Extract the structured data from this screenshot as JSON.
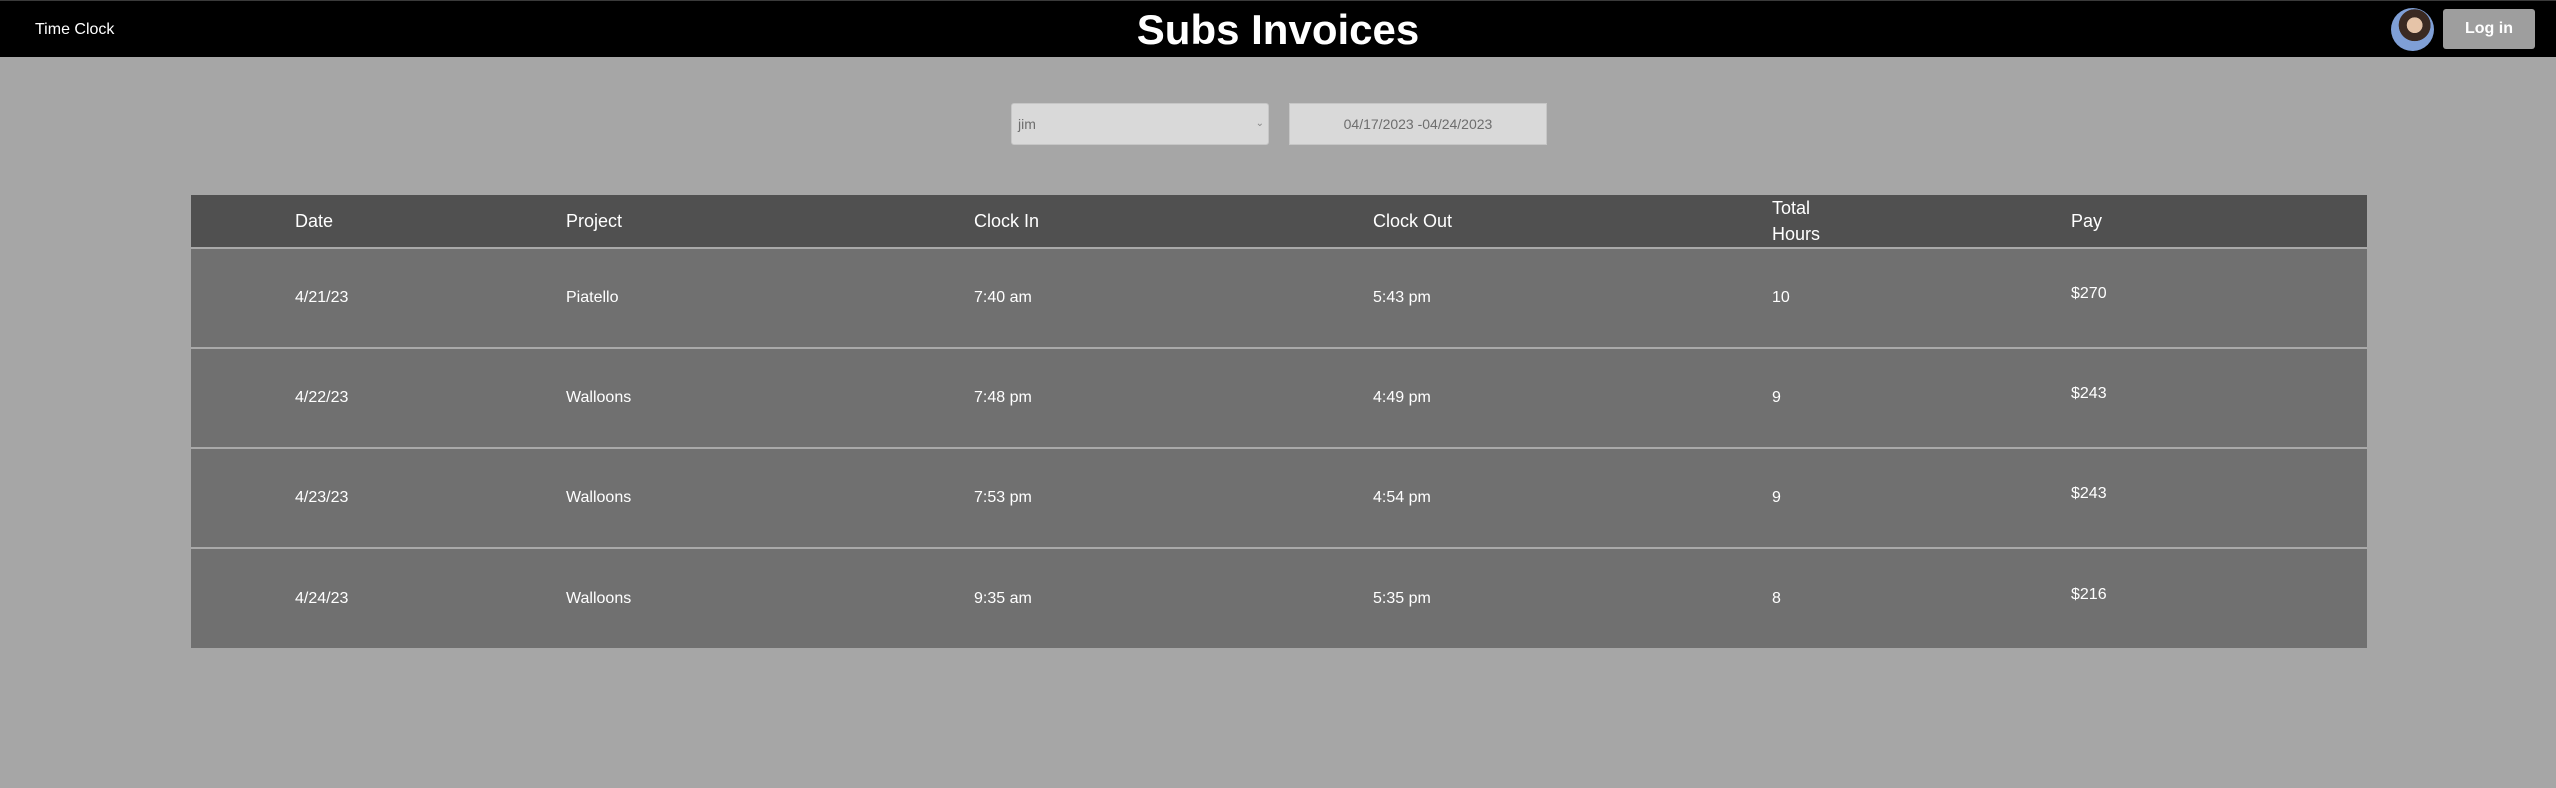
{
  "header": {
    "brand": "Time Clock",
    "title": "Subs Invoices",
    "login_label": "Log in"
  },
  "filters": {
    "worker_selected": "jim",
    "date_range": "04/17/2023 -04/24/2023"
  },
  "table": {
    "columns": [
      "Date",
      "Project",
      "Clock In",
      "Clock Out",
      "Total Hours",
      "Pay"
    ],
    "rows": [
      {
        "date": "4/21/23",
        "project": "Piatello",
        "clock_in": "7:40 am",
        "clock_out": "5:43 pm",
        "total_hours": "10",
        "pay": "$270"
      },
      {
        "date": "4/22/23",
        "project": "Walloons",
        "clock_in": "7:48 pm",
        "clock_out": "4:49 pm",
        "total_hours": "9",
        "pay": "$243"
      },
      {
        "date": "4/23/23",
        "project": "Walloons",
        "clock_in": "7:53 pm",
        "clock_out": "4:54 pm",
        "total_hours": "9",
        "pay": "$243"
      },
      {
        "date": "4/24/23",
        "project": "Walloons",
        "clock_in": "9:35 am",
        "clock_out": "5:35 pm",
        "total_hours": "8",
        "pay": "$216"
      }
    ]
  }
}
